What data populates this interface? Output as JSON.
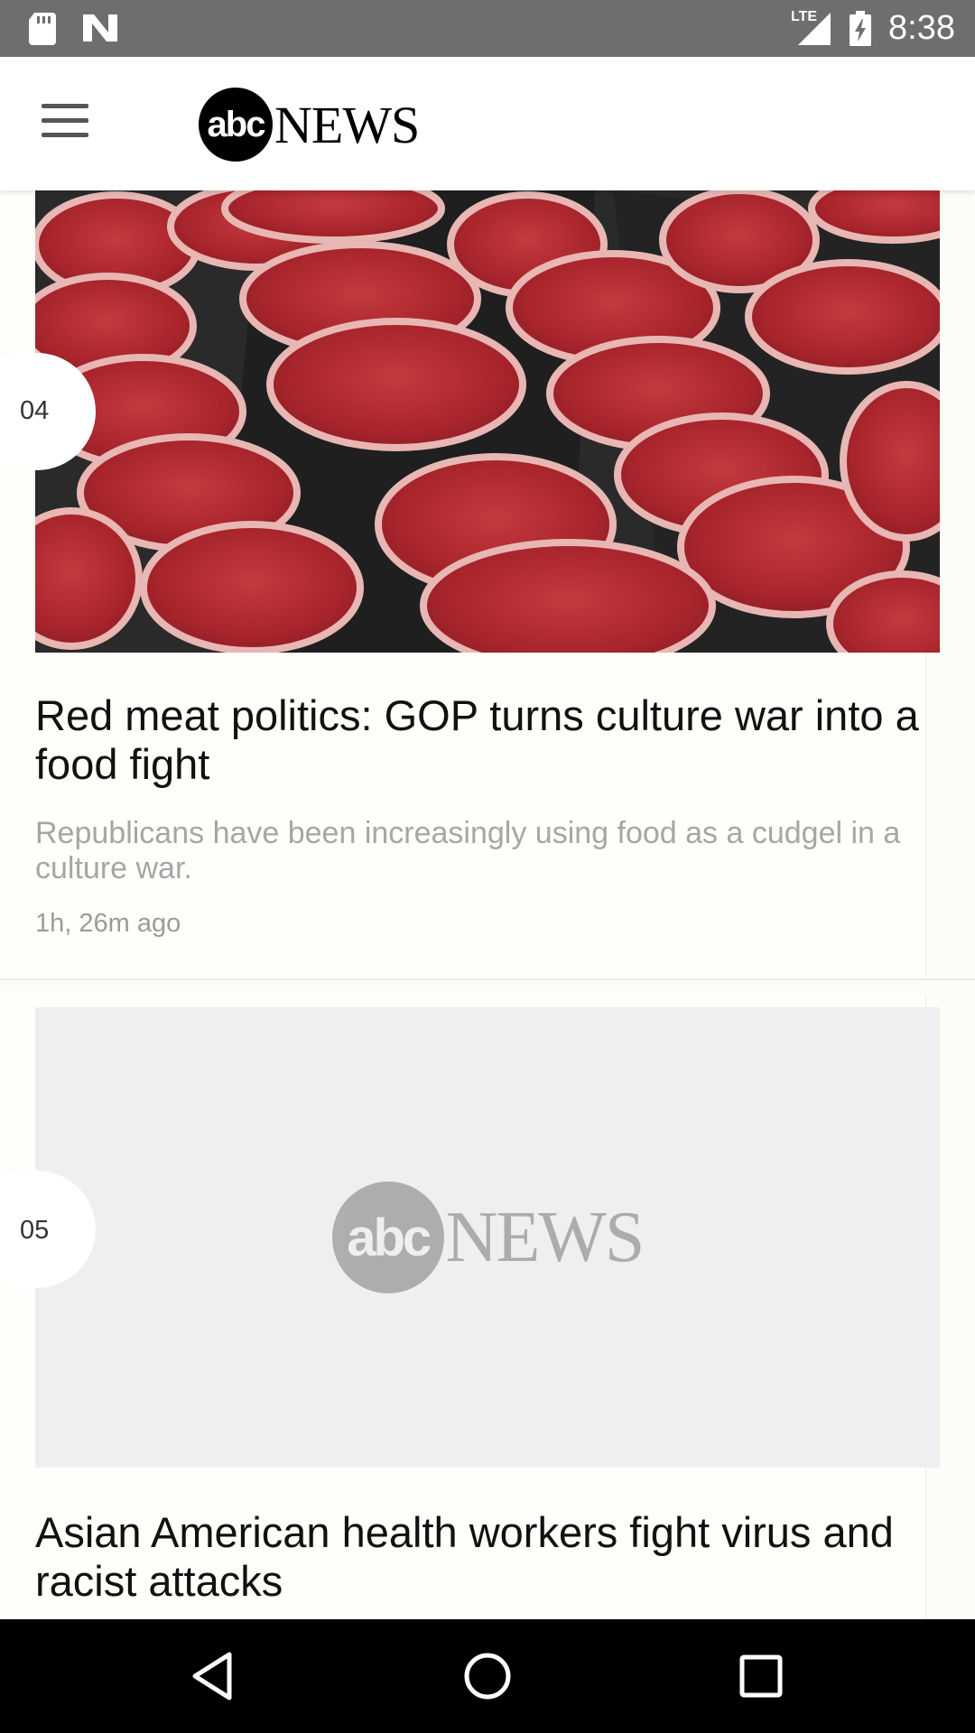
{
  "status_bar": {
    "time": "8:38",
    "network": "LTE",
    "icons": [
      "sd-card-icon",
      "n-notification-icon",
      "lte-signal-icon",
      "battery-charging-icon"
    ]
  },
  "header": {
    "menu_icon": "hamburger-menu-icon",
    "logo": {
      "circle_text": "abc",
      "wordmark": "NEWS"
    }
  },
  "stories": [
    {
      "rank": "04",
      "image": "raw-steaks-photo",
      "headline": "Red meat politics: GOP turns culture war into a food fight",
      "summary": "Republicans have been increasingly using food as a cudgel in a culture war.",
      "time": "1h, 26m ago"
    },
    {
      "rank": "05",
      "image": "abc-news-placeholder",
      "placeholder_logo": {
        "circle_text": "abc",
        "wordmark": "NEWS"
      },
      "headline": "Asian American health workers fight virus and racist attacks"
    }
  ],
  "nav_bar": {
    "back": "back-triangle-icon",
    "home": "home-circle-icon",
    "recents": "recents-square-icon"
  },
  "colors": {
    "status_bar": "#6e6e6e",
    "feed_background": "#fdfcf7",
    "headline": "#111111",
    "summary": "#a6a6a6"
  }
}
